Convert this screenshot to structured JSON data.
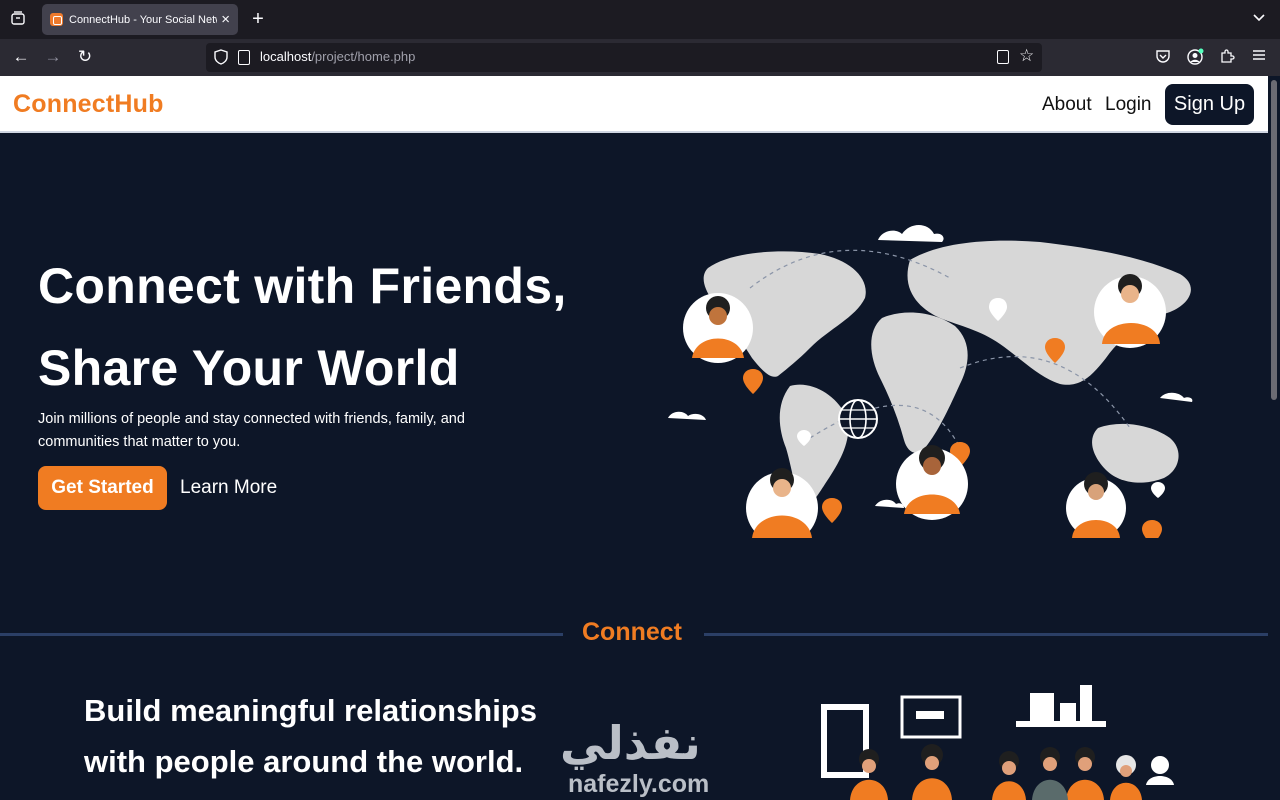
{
  "browser": {
    "tab_title": "ConnectHub - Your Social Network",
    "url_host": "localhost",
    "url_path": "/project/home.php"
  },
  "header": {
    "logo": "ConnectHub",
    "nav": {
      "about": "About",
      "login": "Login",
      "signup": "Sign Up"
    }
  },
  "hero": {
    "title_line1": "Connect with Friends,",
    "title_line2": "Share Your World",
    "subtitle": "Join millions of people and stay connected with friends, family, and communities that matter to you.",
    "cta_primary": "Get Started",
    "cta_secondary": "Learn More"
  },
  "section": {
    "label": "Connect",
    "title_line1": "Build meaningful relationships",
    "title_line2": "with people around the world."
  },
  "watermark": {
    "arabic": "نفذلي",
    "latin": "nafezly.com"
  },
  "colors": {
    "brand": "#f07c22",
    "navy": "#0d1628",
    "white": "#ffffff",
    "map": "#d7d7d7"
  },
  "icons": [
    "tab-list-icon",
    "close-icon",
    "plus-icon",
    "back-icon",
    "forward-icon",
    "reload-icon",
    "shield-icon",
    "page-icon",
    "reader-icon",
    "star-icon",
    "pocket-icon",
    "account-icon",
    "extensions-icon",
    "menu-icon",
    "chevron-down-icon"
  ]
}
